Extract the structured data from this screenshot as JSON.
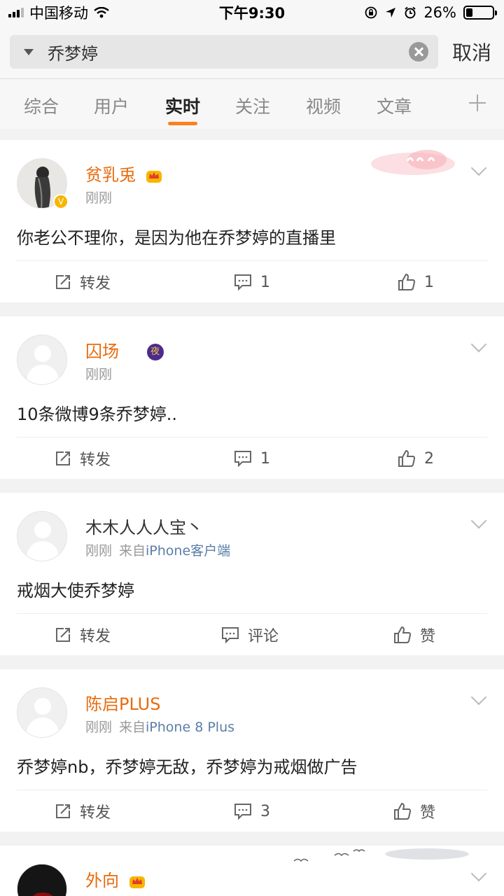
{
  "status_bar": {
    "carrier": "中国移动",
    "time": "下午9:30",
    "battery": "26%",
    "battery_level": 0.26
  },
  "search": {
    "query": "乔梦婷",
    "cancel_label": "取消"
  },
  "tabs": [
    {
      "label": "综合",
      "active": false
    },
    {
      "label": "用户",
      "active": false
    },
    {
      "label": "实时",
      "active": true
    },
    {
      "label": "关注",
      "active": false
    },
    {
      "label": "视频",
      "active": false
    },
    {
      "label": "文章",
      "active": false
    }
  ],
  "posts": [
    {
      "username": "贫乳兎",
      "time": "刚刚",
      "source": "",
      "content": "你老公不理你，是因为他在乔梦婷的直播里",
      "repost_label": "转发",
      "comment": "1",
      "like": "1"
    },
    {
      "username": "囚场",
      "time": "刚刚",
      "source": "",
      "night_badge": "夜",
      "content": "10条微博9条乔梦婷..",
      "repost_label": "转发",
      "comment": "1",
      "like": "2"
    },
    {
      "username": "木木人人人宝丶",
      "time": "刚刚",
      "source_prefix": "来自",
      "source": "iPhone客户端",
      "content": "戒烟大使乔梦婷",
      "repost_label": "转发",
      "comment": "评论",
      "like": "赞"
    },
    {
      "username": "陈启PLUS",
      "time": "刚刚",
      "source_prefix": "来自",
      "source": "iPhone 8 Plus",
      "content": "乔梦婷nb，乔梦婷无敌，乔梦婷为戒烟做广告",
      "repost_label": "转发",
      "comment": "3",
      "like": "赞"
    },
    {
      "username": "外向",
      "time": "",
      "source": ""
    }
  ],
  "colors": {
    "accent": "#ff7f1e",
    "username": "#e86b0c",
    "source_link": "#5b7ea8"
  }
}
